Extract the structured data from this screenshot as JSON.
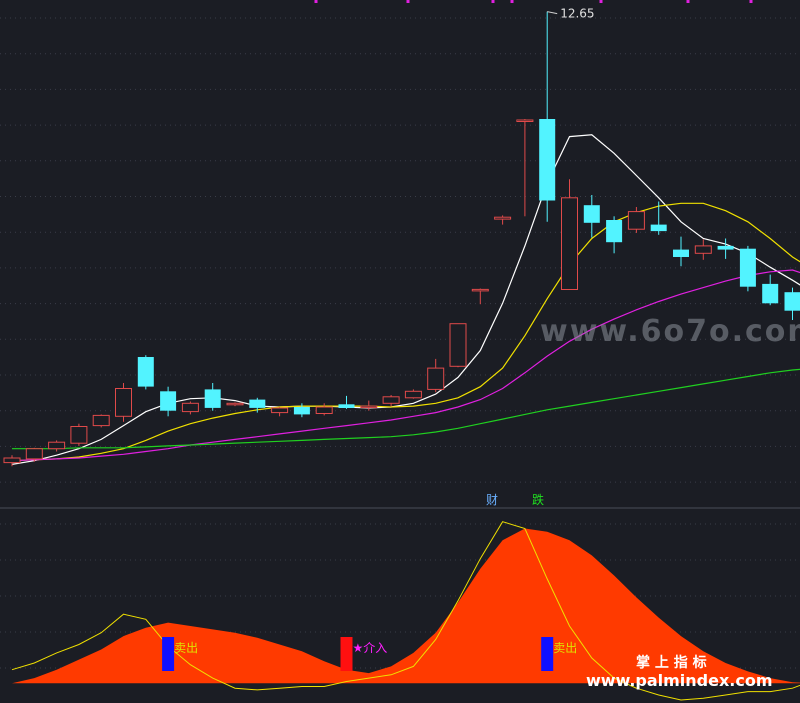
{
  "colors": {
    "background": "#1b1d24",
    "grid": "#3a3d48",
    "up": "#e04a4a",
    "down": "#52f3ff",
    "ma5": "#ffffff",
    "ma10": "#f0e000",
    "ma20": "#e020e0",
    "ma60": "#20d020",
    "area": "#ff3a00",
    "osc_line": "#f0e000",
    "sell_bar": "#1010ff",
    "buy_bar": "#ff1010",
    "sell_text": "#e0e000",
    "buy_text": "#ff20ff",
    "watermark": "#8a8f99"
  },
  "labels": {
    "high_price": "12.65",
    "event_cai": "财",
    "event_die": "跌",
    "watermark_top": "www.6o7o.com",
    "watermark_zh": "掌 上 指 标",
    "watermark_url": "www.palmindex.com"
  },
  "signals": [
    {
      "type": "sell",
      "label": "卖出",
      "index": 7
    },
    {
      "type": "buy",
      "label": "★介入",
      "index": 15
    },
    {
      "type": "sell",
      "label": "卖出",
      "index": 24
    }
  ],
  "chart_data": [
    {
      "type": "candlestick",
      "title": "",
      "ylim": [
        7.7,
        12.7
      ],
      "candles": [
        {
          "o": 7.78,
          "h": 7.86,
          "l": 7.74,
          "c": 7.83
        },
        {
          "o": 7.82,
          "h": 7.94,
          "l": 7.79,
          "c": 7.93
        },
        {
          "o": 7.93,
          "h": 8.02,
          "l": 7.9,
          "c": 8.0
        },
        {
          "o": 7.99,
          "h": 8.2,
          "l": 7.96,
          "c": 8.17
        },
        {
          "o": 8.18,
          "h": 8.3,
          "l": 8.16,
          "c": 8.29
        },
        {
          "o": 8.28,
          "h": 8.64,
          "l": 8.22,
          "c": 8.58
        },
        {
          "o": 8.92,
          "h": 8.94,
          "l": 8.57,
          "c": 8.6
        },
        {
          "o": 8.55,
          "h": 8.6,
          "l": 8.28,
          "c": 8.34
        },
        {
          "o": 8.33,
          "h": 8.44,
          "l": 8.3,
          "c": 8.42
        },
        {
          "o": 8.57,
          "h": 8.64,
          "l": 8.34,
          "c": 8.37
        },
        {
          "o": 8.41,
          "h": 8.43,
          "l": 8.39,
          "c": 8.42
        },
        {
          "o": 8.46,
          "h": 8.48,
          "l": 8.32,
          "c": 8.37
        },
        {
          "o": 8.32,
          "h": 8.38,
          "l": 8.28,
          "c": 8.37
        },
        {
          "o": 8.38,
          "h": 8.42,
          "l": 8.27,
          "c": 8.3
        },
        {
          "o": 8.31,
          "h": 8.42,
          "l": 8.29,
          "c": 8.38
        },
        {
          "o": 8.41,
          "h": 8.5,
          "l": 8.36,
          "c": 8.37
        },
        {
          "o": 8.39,
          "h": 8.45,
          "l": 8.34,
          "c": 8.39
        },
        {
          "o": 8.42,
          "h": 8.51,
          "l": 8.39,
          "c": 8.49
        },
        {
          "o": 8.48,
          "h": 8.57,
          "l": 8.47,
          "c": 8.55
        },
        {
          "o": 8.57,
          "h": 8.9,
          "l": 8.54,
          "c": 8.8
        },
        {
          "o": 8.82,
          "h": 9.28,
          "l": 8.81,
          "c": 9.28
        },
        {
          "o": 9.64,
          "h": 9.66,
          "l": 9.49,
          "c": 9.65
        },
        {
          "o": 10.41,
          "h": 10.45,
          "l": 10.35,
          "c": 10.43
        },
        {
          "o": 11.47,
          "h": 11.49,
          "l": 10.44,
          "c": 11.48
        },
        {
          "o": 11.49,
          "h": 12.65,
          "l": 10.38,
          "c": 10.61
        },
        {
          "o": 9.65,
          "h": 10.84,
          "l": 9.65,
          "c": 10.64
        },
        {
          "o": 10.56,
          "h": 10.67,
          "l": 10.21,
          "c": 10.37
        },
        {
          "o": 10.4,
          "h": 10.44,
          "l": 10.04,
          "c": 10.16
        },
        {
          "o": 10.3,
          "h": 10.54,
          "l": 10.26,
          "c": 10.49
        },
        {
          "o": 10.35,
          "h": 10.6,
          "l": 10.24,
          "c": 10.28
        },
        {
          "o": 10.08,
          "h": 10.22,
          "l": 9.9,
          "c": 10.0
        },
        {
          "o": 10.04,
          "h": 10.19,
          "l": 9.97,
          "c": 10.12
        },
        {
          "o": 10.12,
          "h": 10.2,
          "l": 9.98,
          "c": 10.08
        },
        {
          "o": 10.09,
          "h": 10.12,
          "l": 9.63,
          "c": 9.68
        },
        {
          "o": 9.71,
          "h": 9.81,
          "l": 9.48,
          "c": 9.5
        },
        {
          "o": 9.62,
          "h": 9.67,
          "l": 9.32,
          "c": 9.42
        },
        {
          "o": 9.42,
          "h": 9.63,
          "l": 9.4,
          "c": 9.56
        }
      ],
      "ma": [
        {
          "name": "MA5",
          "values": [
            7.76,
            7.8,
            7.86,
            7.93,
            8.03,
            8.18,
            8.33,
            8.42,
            8.47,
            8.48,
            8.45,
            8.39,
            8.38,
            8.39,
            8.39,
            8.38,
            8.37,
            8.38,
            8.42,
            8.52,
            8.7,
            8.99,
            9.5,
            10.12,
            10.8,
            11.3,
            11.32,
            11.12,
            10.88,
            10.64,
            10.38,
            10.2,
            10.14,
            10.04,
            9.89,
            9.75,
            9.6
          ]
        },
        {
          "name": "MA10",
          "values": [
            7.8,
            7.81,
            7.82,
            7.84,
            7.88,
            7.93,
            8.02,
            8.12,
            8.2,
            8.26,
            8.31,
            8.35,
            8.38,
            8.39,
            8.39,
            8.39,
            8.39,
            8.38,
            8.39,
            8.42,
            8.48,
            8.6,
            8.8,
            9.15,
            9.55,
            9.92,
            10.2,
            10.38,
            10.48,
            10.55,
            10.58,
            10.58,
            10.5,
            10.38,
            10.2,
            10.0,
            9.85
          ]
        },
        {
          "name": "MA20",
          "values": [
            7.8,
            7.81,
            7.82,
            7.83,
            7.85,
            7.87,
            7.9,
            7.93,
            7.97,
            8.0,
            8.03,
            8.06,
            8.09,
            8.12,
            8.15,
            8.18,
            8.21,
            8.24,
            8.28,
            8.32,
            8.38,
            8.46,
            8.58,
            8.75,
            8.93,
            9.09,
            9.22,
            9.33,
            9.43,
            9.52,
            9.6,
            9.67,
            9.74,
            9.8,
            9.84,
            9.86,
            9.78
          ]
        },
        {
          "name": "MA60",
          "values": [
            7.93,
            7.93,
            7.93,
            7.94,
            7.94,
            7.94,
            7.95,
            7.96,
            7.97,
            7.98,
            7.99,
            8.0,
            8.01,
            8.02,
            8.03,
            8.04,
            8.05,
            8.06,
            8.08,
            8.11,
            8.15,
            8.2,
            8.25,
            8.3,
            8.35,
            8.39,
            8.43,
            8.47,
            8.51,
            8.55,
            8.59,
            8.63,
            8.67,
            8.71,
            8.75,
            8.78,
            8.8
          ]
        }
      ]
    },
    {
      "type": "area",
      "title": "",
      "ylim": [
        -1,
        10
      ],
      "area_values": [
        0.0,
        0.3,
        0.8,
        1.4,
        2.0,
        2.8,
        3.3,
        3.6,
        3.4,
        3.2,
        3.0,
        2.7,
        2.3,
        1.9,
        1.3,
        0.8,
        0.6,
        1.0,
        1.8,
        3.0,
        4.8,
        6.8,
        8.5,
        9.2,
        9.0,
        8.5,
        7.6,
        6.4,
        5.1,
        3.9,
        2.8,
        1.9,
        1.2,
        0.7,
        0.3,
        0.05,
        0.0
      ],
      "line_values": [
        0.8,
        1.2,
        1.8,
        2.3,
        3.0,
        4.1,
        3.8,
        2.2,
        1.1,
        0.3,
        -0.3,
        -0.4,
        -0.3,
        -0.2,
        -0.2,
        0.1,
        0.3,
        0.5,
        1.0,
        2.6,
        4.9,
        7.4,
        9.6,
        9.2,
        6.2,
        3.4,
        1.5,
        0.3,
        -0.3,
        -0.7,
        -1.0,
        -0.9,
        -0.7,
        -0.5,
        -0.5,
        -0.3,
        0.2
      ]
    }
  ]
}
